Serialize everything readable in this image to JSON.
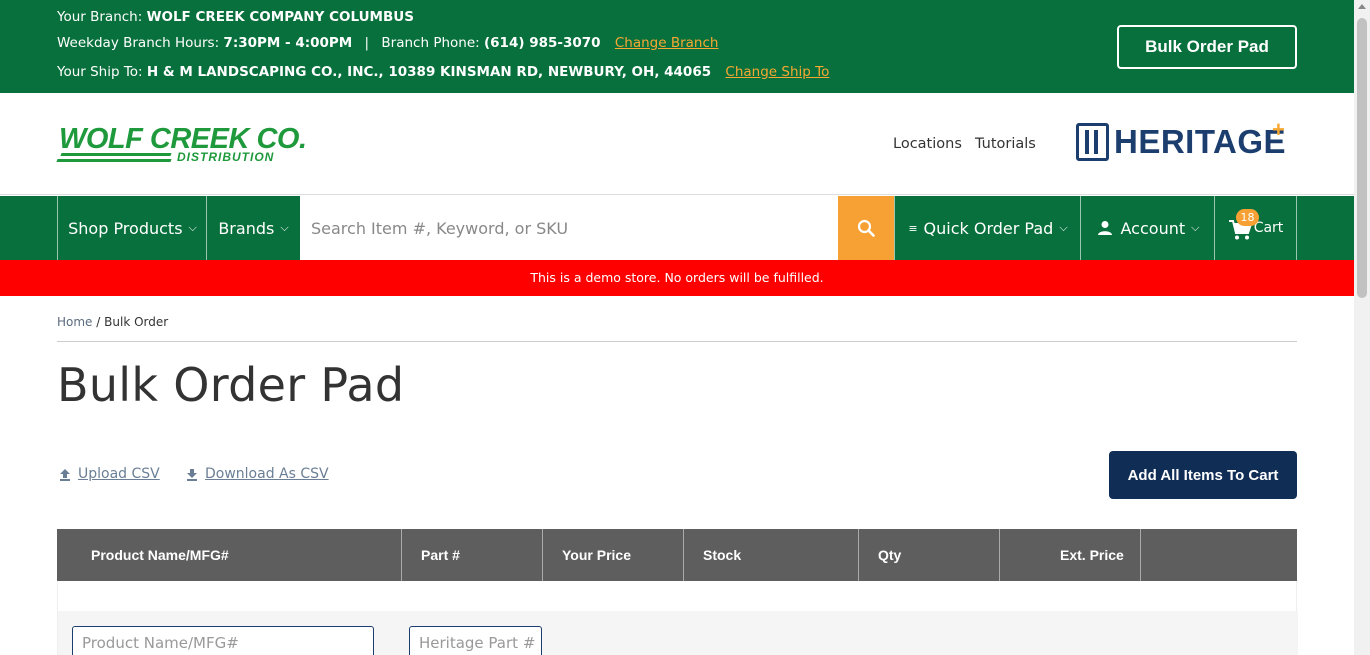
{
  "topbar": {
    "branch_label": "Your Branch:",
    "branch_name": "WOLF CREEK COMPANY COLUMBUS",
    "hours_label": "Weekday Branch Hours:",
    "hours_value": "7:30PM - 4:00PM",
    "separator": "|",
    "phone_label": "Branch Phone:",
    "phone_value": "(614) 985-3070",
    "change_branch": "Change Branch",
    "shipto_label": "Your Ship To:",
    "shipto_value": "H & M LANDSCAPING CO., INC., 10389 KINSMAN RD, NEWBURY, OH, 44065",
    "change_shipto": "Change Ship To",
    "bulk_order_button": "Bulk Order Pad"
  },
  "header": {
    "logo_name": "WOLF CREEK CO.",
    "logo_sub": "DISTRIBUTION",
    "links": [
      "Locations",
      "Tutorials"
    ],
    "partner_logo": "HERITAGE",
    "partner_logo_mark": "+"
  },
  "nav": {
    "shop_products": "Shop Products",
    "brands": "Brands",
    "search_placeholder": "Search Item #, Keyword, or SKU",
    "quick_order_pad": "Quick Order Pad",
    "account": "Account",
    "cart": "Cart",
    "cart_count": "18"
  },
  "demo_banner": "This is a demo store. No orders will be fulfilled.",
  "breadcrumb": {
    "home": "Home",
    "separator": "/",
    "current": "Bulk Order"
  },
  "page_title": "Bulk Order Pad",
  "actions": {
    "upload_csv": "Upload CSV",
    "download_csv": "Download As CSV",
    "add_all": "Add All Items To Cart"
  },
  "table": {
    "headers": [
      "Product Name/MFG#",
      "Part #",
      "Your Price",
      "Stock",
      "Qty",
      "Ext. Price"
    ],
    "row_placeholders": {
      "product": "Product Name/MFG#",
      "part": "Heritage Part #"
    }
  },
  "colors": {
    "brand_green": "#08703c",
    "accent_orange": "#f7a134",
    "navy": "#0f2d55",
    "demo_red": "#ff0000"
  }
}
